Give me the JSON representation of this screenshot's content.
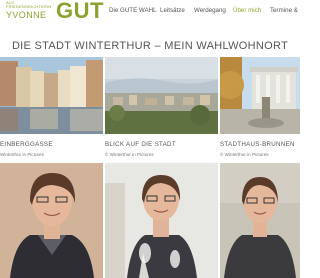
{
  "logo": {
    "small_text": "ALS\nFRIEDENSRICHTERIN",
    "first_name": "YVONNE",
    "last_name": "GUT"
  },
  "nav": {
    "items": [
      {
        "label": "Die GUTE WAHL",
        "active": false
      },
      {
        "label": "Leitsätze",
        "active": false
      },
      {
        "label": "Werdegang",
        "active": false
      },
      {
        "label": "Über mich",
        "active": true
      },
      {
        "label": "Termine &",
        "active": false
      }
    ]
  },
  "page": {
    "title": "DIE STADT WINTERTHUR – MEIN WAHLWOHNORT"
  },
  "gallery": [
    {
      "caption": "EINBERGGASSE",
      "credit": "Winterthur in Pictures"
    },
    {
      "caption": "BLICK AUF DIE STADT",
      "credit": "© Winterthur in Pictures"
    },
    {
      "caption": "STADTHAUS-BRUNNEN",
      "credit": "© Winterthur in Pictures"
    }
  ],
  "colors": {
    "brand_green": "#8aa22e",
    "text_gray": "#555555"
  }
}
